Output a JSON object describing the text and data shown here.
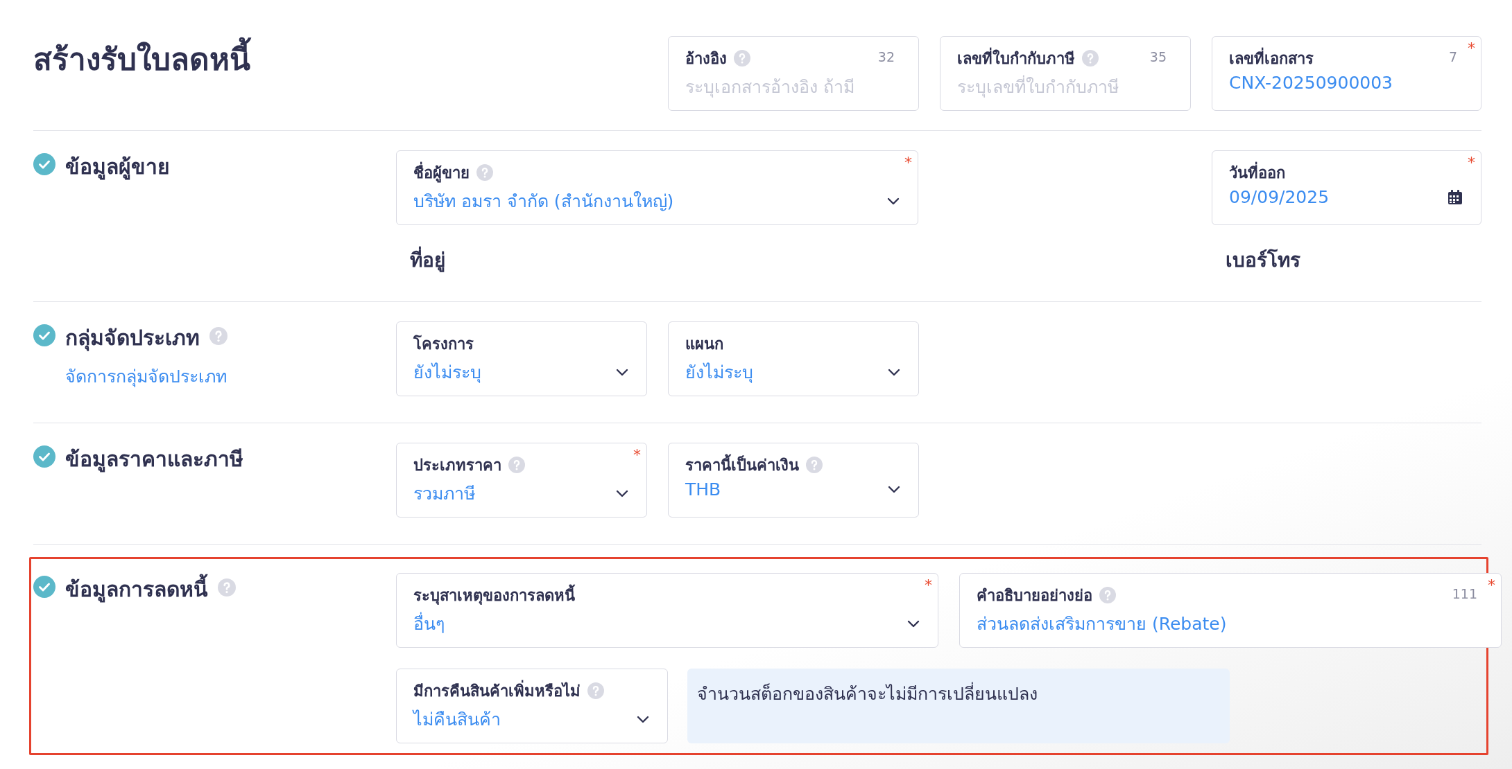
{
  "title": "สร้างรับใบลดหนี้",
  "header_fields": [
    {
      "label": "อ้างอิง",
      "help": true,
      "counter": "32",
      "placeholder": "ระบุเอกสารอ้างอิง ถ้ามี"
    },
    {
      "label": "เลขที่ใบกำกับภาษี",
      "help": true,
      "counter": "35",
      "placeholder": "ระบุเลขที่ใบกำกับภาษี"
    },
    {
      "label": "เลขที่เอกสาร",
      "help": false,
      "counter": "7",
      "required_mark": "*",
      "value": "CNX-20250900003"
    }
  ],
  "sections": [
    {
      "kind": "vendor",
      "title": "ข้อมูลผู้ขาย",
      "completed": true,
      "help": false,
      "highlighted": false,
      "fields": [
        {
          "kind": "select",
          "label": "ชื่อผู้ขาย",
          "help": true,
          "required_mark": "*",
          "value": "บริษัท อมรา จำกัด (สำนักงานใหญ่)"
        },
        {
          "kind": "date",
          "label": "วันที่ออก",
          "help": false,
          "required_mark": "*",
          "value": "09/09/2025"
        },
        {
          "kind": "caption",
          "label": "ที่อยู่"
        },
        {
          "kind": "caption",
          "label": "เบอร์โทร"
        }
      ]
    },
    {
      "kind": "grouping",
      "title": "กลุ่มจัดประเภท",
      "completed": true,
      "help": true,
      "highlighted": false,
      "link": "จัดการกลุ่มจัดประเภท",
      "fields": [
        {
          "kind": "select",
          "label": "โครงการ",
          "help": false,
          "value": "ยังไม่ระบุ"
        },
        {
          "kind": "select",
          "label": "แผนก",
          "help": false,
          "value": "ยังไม่ระบุ"
        }
      ]
    },
    {
      "kind": "pricing",
      "title": "ข้อมูลราคาและภาษี",
      "completed": true,
      "help": false,
      "highlighted": false,
      "fields": [
        {
          "kind": "select",
          "label": "ประเภทราคา",
          "help": true,
          "required_mark": "*",
          "value": "รวมภาษี"
        },
        {
          "kind": "select",
          "label": "ราคานี้เป็นค่าเงิน",
          "help": true,
          "value": "THB"
        }
      ]
    },
    {
      "kind": "reduction",
      "title": "ข้อมูลการลดหนี้",
      "completed": true,
      "help": true,
      "highlighted": true,
      "fields": [
        {
          "kind": "select",
          "label": "ระบุสาเหตุของการลดหนี้",
          "help": false,
          "required_mark": "*",
          "value": "อื่นๆ"
        },
        {
          "kind": "text",
          "label": "คำอธิบายอย่างย่อ",
          "help": true,
          "counter": "111",
          "required_mark": "*",
          "value": "ส่วนลดส่งเสริมการขาย (Rebate)"
        },
        {
          "kind": "select",
          "label": "มีการคืนสินค้าเพิ่มหรือไม่",
          "help": true,
          "value": "ไม่คืนสินค้า"
        },
        {
          "kind": "note",
          "text": "จำนวนสต็อกของสินค้าจะไม่มีการเปลี่ยนแปลง"
        }
      ]
    }
  ]
}
